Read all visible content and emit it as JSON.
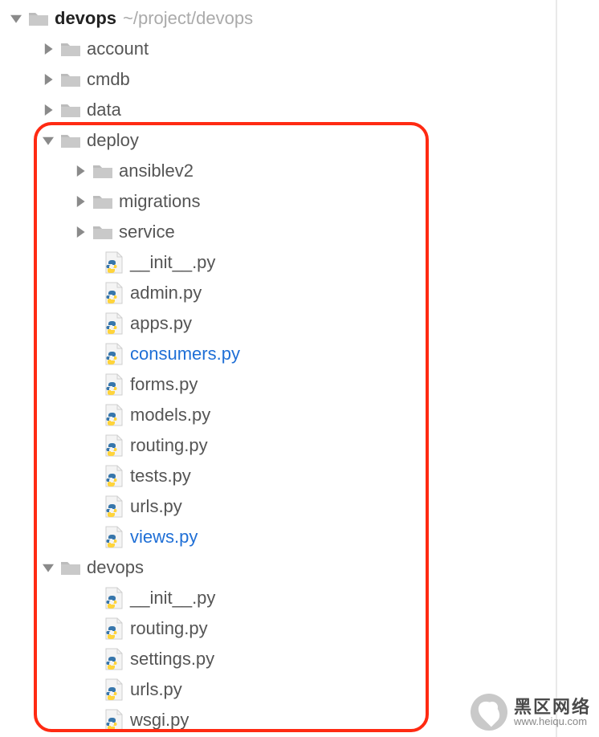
{
  "root": {
    "name": "devops",
    "path": "~/project/devops"
  },
  "folders_level1": {
    "account": "account",
    "cmdb": "cmdb",
    "data": "data",
    "deploy": "deploy",
    "devops": "devops"
  },
  "deploy_subfolders": {
    "ansiblev2": "ansiblev2",
    "migrations": "migrations",
    "service": "service"
  },
  "deploy_files": {
    "init": "__init__.py",
    "admin": "admin.py",
    "apps": "apps.py",
    "consumers": "consumers.py",
    "forms": "forms.py",
    "models": "models.py",
    "routing": "routing.py",
    "tests": "tests.py",
    "urls": "urls.py",
    "views": "views.py"
  },
  "devops_files": {
    "init": "__init__.py",
    "routing": "routing.py",
    "settings": "settings.py",
    "urls": "urls.py",
    "wsgi": "wsgi.py"
  },
  "watermark": {
    "cn": "黑区网络",
    "url": "www.heiqu.com"
  }
}
